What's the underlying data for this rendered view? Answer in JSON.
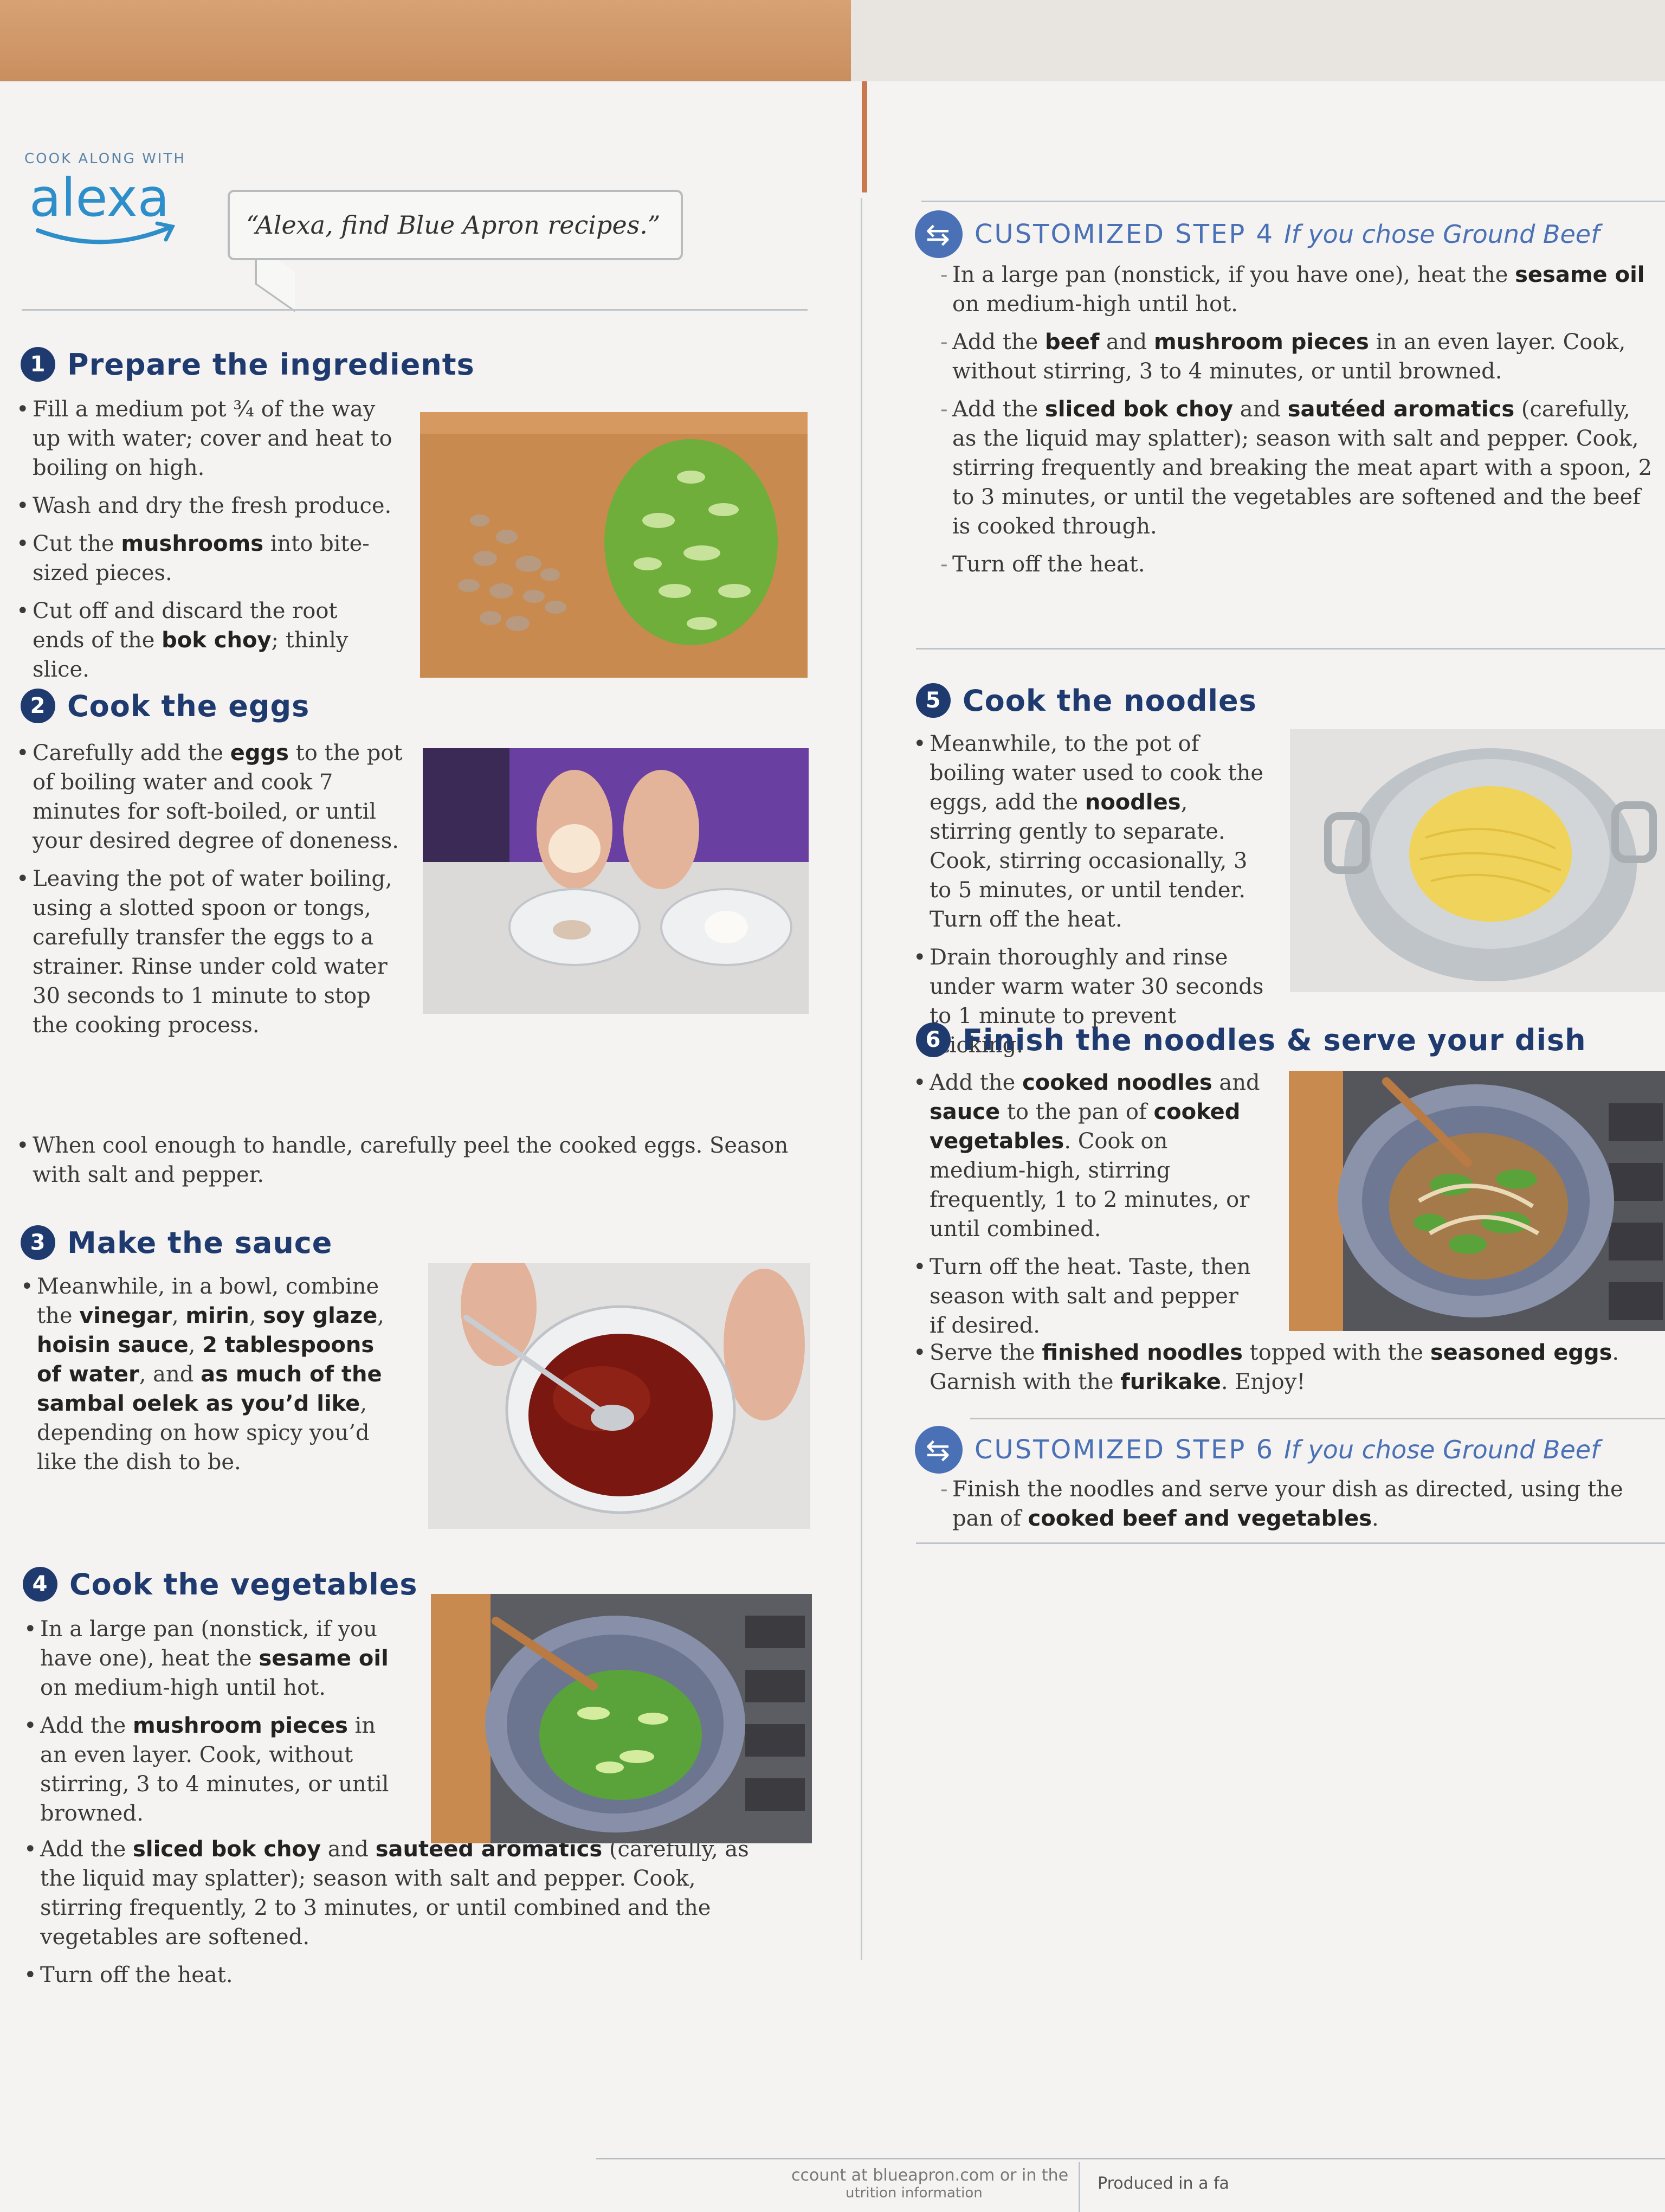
{
  "header": {
    "cook_along": "COOK ALONG WITH",
    "brand": "alexa",
    "voice_prompt": "“Alexa, find Blue Apron recipes.”"
  },
  "steps": {
    "s1": {
      "num": "1",
      "title": "Prepare the ingredients",
      "b1": "Fill a medium pot ¾ of the way up with water; cover and heat to boiling on high.",
      "b2": "Wash and dry the fresh produce.",
      "b3_pre": "Cut the ",
      "b3_bold": "mushrooms",
      "b3_post": " into bite-sized pieces.",
      "b4_pre": "Cut off and discard the root ends of the ",
      "b4_bold": "bok choy",
      "b4_post": "; thinly slice."
    },
    "s2": {
      "num": "2",
      "title": "Cook the eggs",
      "b1_pre": "Carefully add the ",
      "b1_bold": "eggs",
      "b1_post": " to the pot of boiling water and cook 7 minutes for soft-boiled, or until your desired degree of doneness.",
      "b2": "Leaving the pot of water boiling, using a slotted spoon or tongs, carefully transfer the eggs to a strainer. Rinse under cold water 30 seconds to 1 minute to stop the cooking process.",
      "b3": "When cool enough to handle, carefully peel the cooked eggs. Season with salt and pepper."
    },
    "s3": {
      "num": "3",
      "title": "Make the sauce",
      "b1_pre": "Meanwhile, in a bowl, combine the ",
      "b1_bold1": "vinegar",
      "b1_sep1": ", ",
      "b1_bold2": "mirin",
      "b1_sep2": ", ",
      "b1_bold3": "soy glaze",
      "b1_sep3": ", ",
      "b1_bold4": "hoisin sauce",
      "b1_sep4": ", ",
      "b1_bold5": "2 tablespoons of water",
      "b1_sep5": ", and ",
      "b1_bold6": "as much of the sambal oelek as you’d like",
      "b1_post": ", depending on how spicy you’d like the dish to be."
    },
    "s4": {
      "num": "4",
      "title": "Cook the vegetables",
      "b1_pre": "In a large pan (nonstick, if you have one), heat the ",
      "b1_bold": "sesame oil",
      "b1_post": " on medium-high until hot.",
      "b2_pre": "Add the ",
      "b2_bold": "mushroom pieces",
      "b2_post": " in an even layer. Cook, without stirring, 3 to 4 minutes, or until browned.",
      "b3_pre": "Add the ",
      "b3_bold1": "sliced bok choy",
      "b3_mid": " and ",
      "b3_bold2": "sautéed aromatics",
      "b3_post": " (carefully, as the liquid may splatter); season with salt and pepper. Cook, stirring frequently, 2 to 3 minutes, or until combined and the vegetables are softened.",
      "b4": "Turn off the heat."
    },
    "c4": {
      "title": "CUSTOMIZED STEP 4",
      "sub": "If you chose Ground Beef",
      "d1_pre": "In a large pan (nonstick, if you have one), heat the ",
      "d1_bold": "sesame oil",
      "d1_post": " on medium-high until hot.",
      "d2_pre": "Add the ",
      "d2_bold1": "beef",
      "d2_mid": " and ",
      "d2_bold2": "mushroom pieces",
      "d2_post": " in an even layer. Cook, without stirring, 3 to 4 minutes, or until browned.",
      "d3_pre": "Add the ",
      "d3_bold1": "sliced bok choy",
      "d3_mid": " and ",
      "d3_bold2": "sautéed aromatics",
      "d3_post": " (carefully, as the liquid may splatter); season with salt and pepper. Cook, stirring frequently and breaking the meat apart with a spoon, 2 to 3 minutes, or until the vegetables are softened and the beef is cooked through.",
      "d4": "Turn off the heat."
    },
    "s5": {
      "num": "5",
      "title": "Cook the noodles",
      "b1_pre": "Meanwhile, to the pot of boiling water used to cook the eggs, add the ",
      "b1_bold": "noodles",
      "b1_post": ", stirring gently to separate. Cook, stirring occasionally, 3 to 5 minutes, or until tender. Turn off the heat.",
      "b2": "Drain thoroughly and rinse under warm water 30 seconds to 1 minute to prevent sticking."
    },
    "s6": {
      "num": "6",
      "title": "Finish the noodles & serve your dish",
      "b1_pre": "Add the ",
      "b1_bold1": "cooked noodles",
      "b1_mid": " and ",
      "b1_bold2": "sauce",
      "b1_mid2": " to the pan of ",
      "b1_bold3": "cooked vegetables",
      "b1_post": ". Cook on medium-high, stirring frequently, 1 to 2 minutes, or until combined.",
      "b2": "Turn off the heat. Taste, then season with salt and pepper if desired.",
      "b3_pre": "Serve the ",
      "b3_bold1": "finished noodles",
      "b3_mid": " topped with the ",
      "b3_bold2": "seasoned eggs",
      "b3_mid2": ". Garnish with the ",
      "b3_bold3": "furikake",
      "b3_post": ". Enjoy!"
    },
    "c6": {
      "title": "CUSTOMIZED STEP 6",
      "sub": "If you chose Ground Beef",
      "d1_pre": "Finish the noodles and serve your dish as directed, using the pan of ",
      "d1_bold": "cooked beef and vegetables",
      "d1_post": "."
    }
  },
  "footer": {
    "left1": "ccount at blueapron.com or in the",
    "left2": "utrition information",
    "right": "Produced in a fa"
  },
  "colors": {
    "navy": "#1f3a6e",
    "accent_blue": "#4a71b5",
    "alexa_blue": "#2d8ec9",
    "paper": "#f4f3f2"
  },
  "icons": [
    "alexa-smile-logo",
    "swap-arrows-icon"
  ]
}
